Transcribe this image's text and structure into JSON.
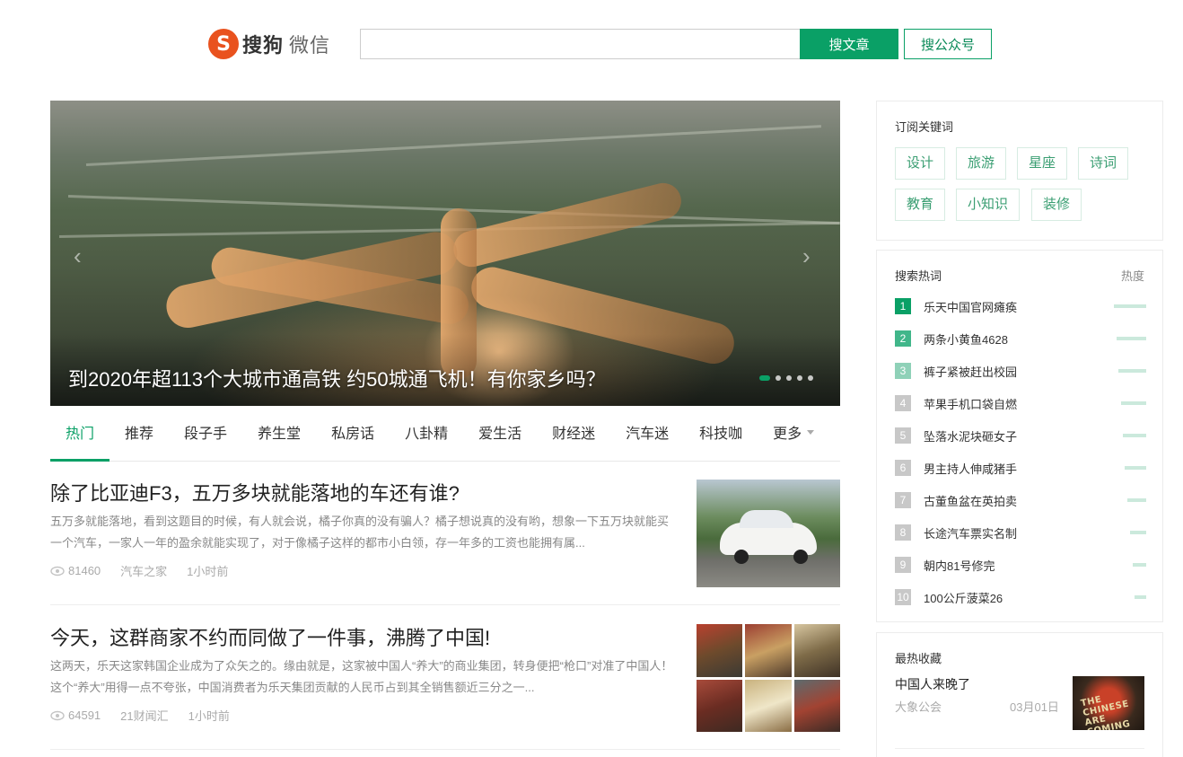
{
  "header": {
    "logo_badge": "S",
    "logo_brand": "搜狗",
    "logo_sub": "微信",
    "search_value": "",
    "btn_article": "搜文章",
    "btn_account": "搜公众号"
  },
  "hero": {
    "caption": "到2020年超113个大城市通高铁 约50城通飞机！有你家乡吗？",
    "prev_arrow": "‹",
    "next_arrow": "›",
    "slide_count": 5,
    "active_slide": 1
  },
  "tabs": [
    "热门",
    "推荐",
    "段子手",
    "养生堂",
    "私房话",
    "八卦精",
    "爱生活",
    "财经迷",
    "汽车迷",
    "科技咖",
    "更多"
  ],
  "articles": [
    {
      "title": "除了比亚迪F3，五万多块就能落地的车还有谁?",
      "summary": "五万多就能落地，看到这题目的时候，有人就会说，橘子你真的没有骗人？橘子想说真的没有哟，想象一下五万块就能买一个汽车，一家人一年的盈余就能实现了，对于像橘子这样的都市小白领，存一年多的工资也能拥有属...",
      "views": "81460",
      "source": "汽车之家",
      "time": "1小时前"
    },
    {
      "title": "今天，这群商家不约而同做了一件事，沸腾了中国!",
      "summary": "这两天，乐天这家韩国企业成为了众矢之的。缘由就是，这家被中国人“养大”的商业集团，转身便把“枪口”对准了中国人！这个“养大”用得一点不夸张，中国消费者为乐天集团贡献的人民币占到其全销售额近三分之一...",
      "views": "64591",
      "source": "21财闻汇",
      "time": "1小时前"
    }
  ],
  "sidebar": {
    "subscribe": {
      "title": "订阅关键词",
      "keywords": [
        "设计",
        "旅游",
        "星座",
        "诗词",
        "教育",
        "小知识",
        "装修"
      ]
    },
    "hot": {
      "title": "搜索热词",
      "heat_label": "热度",
      "items": [
        {
          "rank": "1",
          "text": "乐天中国官网瘫痪",
          "heat": 1.0
        },
        {
          "rank": "2",
          "text": "两条小黄鱼4628",
          "heat": 0.92
        },
        {
          "rank": "3",
          "text": "裤子紧被赶出校园",
          "heat": 0.86
        },
        {
          "rank": "4",
          "text": "苹果手机口袋自燃",
          "heat": 0.78
        },
        {
          "rank": "5",
          "text": "坠落水泥块砸女子",
          "heat": 0.72
        },
        {
          "rank": "6",
          "text": "男主持人伸咸猪手",
          "heat": 0.66
        },
        {
          "rank": "7",
          "text": "古董鱼盆在英拍卖",
          "heat": 0.58
        },
        {
          "rank": "8",
          "text": "长途汽车票实名制",
          "heat": 0.5
        },
        {
          "rank": "9",
          "text": "朝内81号修完",
          "heat": 0.42
        },
        {
          "rank": "10",
          "text": "100公斤菠菜26",
          "heat": 0.36
        }
      ]
    },
    "favorites": {
      "title": "最热收藏",
      "item_title": "中国人来晚了",
      "item_source": "大象公会",
      "item_date": "03月01日",
      "thumb_text": "THE CHINESE ARE COMING"
    }
  }
}
